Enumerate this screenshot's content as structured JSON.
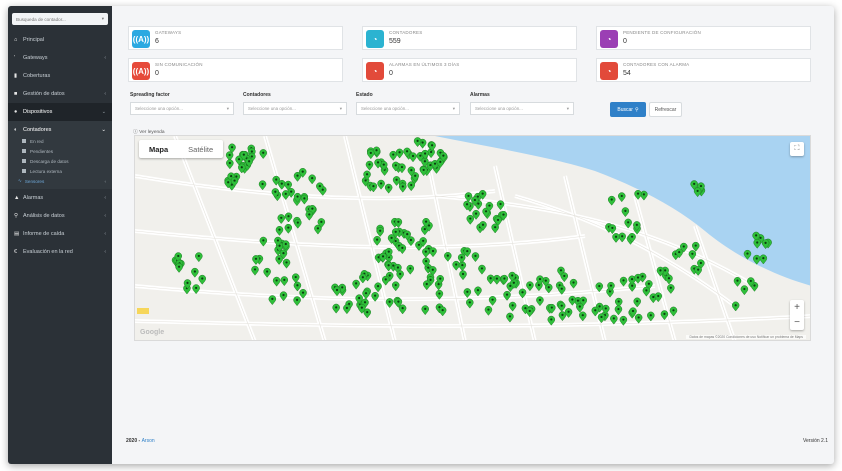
{
  "sidebar": {
    "search_placeholder": "Busqueda de contador...",
    "items": [
      {
        "label": "Principal",
        "icon": "home-icon"
      },
      {
        "label": "Gateways",
        "icon": "antenna-icon"
      },
      {
        "label": "Coberturas",
        "icon": "bar-chart-icon"
      },
      {
        "label": "Gestión de datos",
        "icon": "database-icon"
      },
      {
        "label": "Dispositivos",
        "icon": "device-icon"
      }
    ],
    "submenu": {
      "head": "Contadores",
      "items": [
        "En red",
        "Pendientes",
        "Descarga de datos",
        "Lectura externa"
      ],
      "sensores": "Sensores"
    },
    "items_after": [
      {
        "label": "Alarmas",
        "icon": "warning-icon"
      },
      {
        "label": "Análisis de datos",
        "icon": "search-icon"
      },
      {
        "label": "Informe de caída",
        "icon": "file-icon"
      },
      {
        "label": "Evaluación en la red",
        "icon": "euro-icon"
      }
    ]
  },
  "cards": [
    {
      "label": "GATEWAYS",
      "value": "6",
      "color": "#2ba9e1",
      "icon": "antenna-icon"
    },
    {
      "label": "CONTADORES",
      "value": "559",
      "color": "#2bb3d1",
      "icon": "gauge-icon"
    },
    {
      "label": "PENDIENTE DE CONFIGURACIÓN",
      "value": "0",
      "color": "#9b3fb4",
      "icon": "gauge-icon"
    },
    {
      "label": "SIN COMUNICACIÓN",
      "value": "0",
      "color": "#e64a3a",
      "icon": "antenna-icon"
    },
    {
      "label": "ALARMAS EN ÚLTIMOS 3 DÍAS",
      "value": "0",
      "color": "#e24a3a",
      "icon": "gauge-icon"
    },
    {
      "label": "CONTADORES CON ALARMA",
      "value": "54",
      "color": "#e24a3a",
      "icon": "gauge-icon"
    }
  ],
  "filters": {
    "spreading_label": "Spreading factor",
    "spreading_placeholder": "Seleccione una opción...",
    "contadores_label": "Contadores",
    "contadores_placeholder": "Seleccione una opción...",
    "estado_label": "Estado",
    "estado_placeholder": "Seleccione una opción...",
    "alarmas_label": "Alarmas",
    "alarmas_placeholder": "Seleccione una opción...",
    "search_button": "Buscar",
    "refresh_button": "Refrescar"
  },
  "leyenda": "Ver leyenda",
  "map": {
    "tab_map": "Mapa",
    "tab_satellite": "Satélite",
    "zoom_in": "+",
    "zoom_out": "−",
    "attribution": "Datos de mapas ©2020  Condiciones de uso  Notificar un problema de Maps",
    "google": "Google",
    "marker_color": "#2fbf3a",
    "water_color": "#a9d3f2"
  },
  "footer": {
    "year": "2020 - ",
    "brand": "Arson",
    "version": "Versión 2.1"
  }
}
